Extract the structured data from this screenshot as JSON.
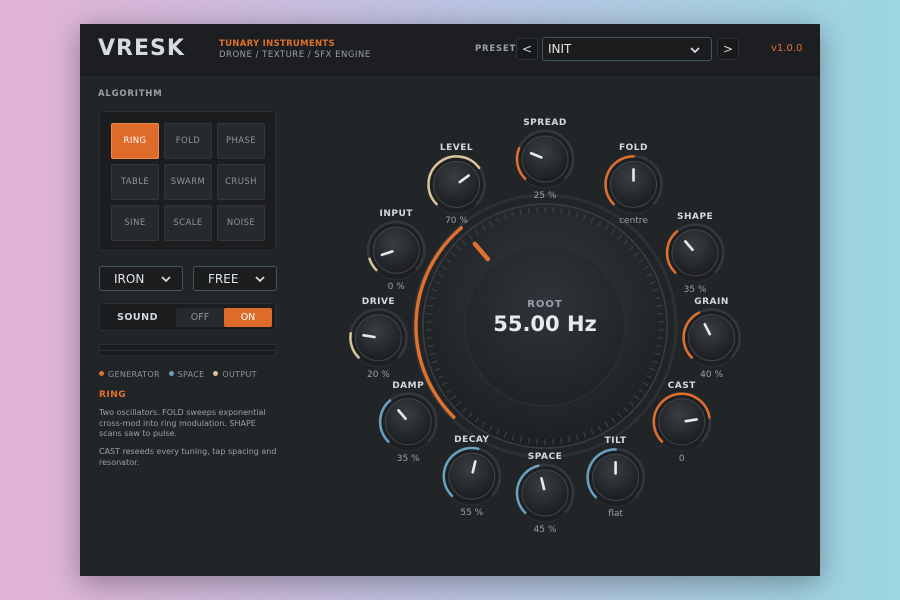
{
  "app": {
    "name": "VRESK",
    "brand": "TUNARY INSTRUMENTS",
    "tagline": "DRONE / TEXTURE / SFX ENGINE",
    "version": "v1.0.0"
  },
  "preset": {
    "label": "PRESET",
    "prev": "<",
    "next": ">",
    "value": "INIT"
  },
  "algorithm": {
    "label": "ALGORITHM",
    "buttons": [
      "RING",
      "FOLD",
      "PHASE",
      "TABLE",
      "SWARM",
      "CRUSH",
      "SINE",
      "SCALE",
      "NOISE"
    ],
    "selected": "RING"
  },
  "dropdowns": {
    "left": "IRON",
    "right": "FREE"
  },
  "sound": {
    "label": "SOUND",
    "off": "OFF",
    "on": "ON",
    "state": "ON"
  },
  "legend": [
    {
      "label": "GENERATOR",
      "color": "#e0702e"
    },
    {
      "label": "SPACE",
      "color": "#6aa0c0"
    },
    {
      "label": "OUTPUT",
      "color": "#d9c39a"
    }
  ],
  "info": {
    "title": "RING",
    "desc1": "Two oscillators. FOLD sweeps exponential cross-mod into ring modulation. SHAPE scans saw to pulse.",
    "desc2": "CAST reseeds every tuning, tap spacing and resonator."
  },
  "root": {
    "label": "ROOT",
    "value": "55.00 Hz"
  },
  "colors": {
    "accent": "#e0702e",
    "space": "#6aa0c0",
    "output": "#d9c39a",
    "panel": "#222528"
  },
  "knobs": [
    {
      "id": "spread",
      "label": "SPREAD",
      "value": "25 %",
      "level": 0.25,
      "group": "generator"
    },
    {
      "id": "fold",
      "label": "FOLD",
      "value": "centre",
      "level": 0.5,
      "group": "generator"
    },
    {
      "id": "shape",
      "label": "SHAPE",
      "value": "35 %",
      "level": 0.35,
      "group": "generator"
    },
    {
      "id": "grain",
      "label": "GRAIN",
      "value": "40 %",
      "level": 0.4,
      "group": "generator"
    },
    {
      "id": "cast",
      "label": "CAST",
      "value": "0",
      "level": 0.8,
      "group": "generator"
    },
    {
      "id": "tilt",
      "label": "TILT",
      "value": "flat",
      "level": 0.5,
      "group": "space"
    },
    {
      "id": "space",
      "label": "SPACE",
      "value": "45 %",
      "level": 0.45,
      "group": "space"
    },
    {
      "id": "decay",
      "label": "DECAY",
      "value": "55 %",
      "level": 0.55,
      "group": "space"
    },
    {
      "id": "damp",
      "label": "DAMP",
      "value": "35 %",
      "level": 0.35,
      "group": "space"
    },
    {
      "id": "drive",
      "label": "DRIVE",
      "value": "20 %",
      "level": 0.2,
      "group": "output"
    },
    {
      "id": "input",
      "label": "INPUT",
      "value": "0 %",
      "level": 0.1,
      "group": "output"
    },
    {
      "id": "level",
      "label": "LEVEL",
      "value": "70 %",
      "level": 0.7,
      "group": "output"
    }
  ],
  "root_level": 0.35
}
